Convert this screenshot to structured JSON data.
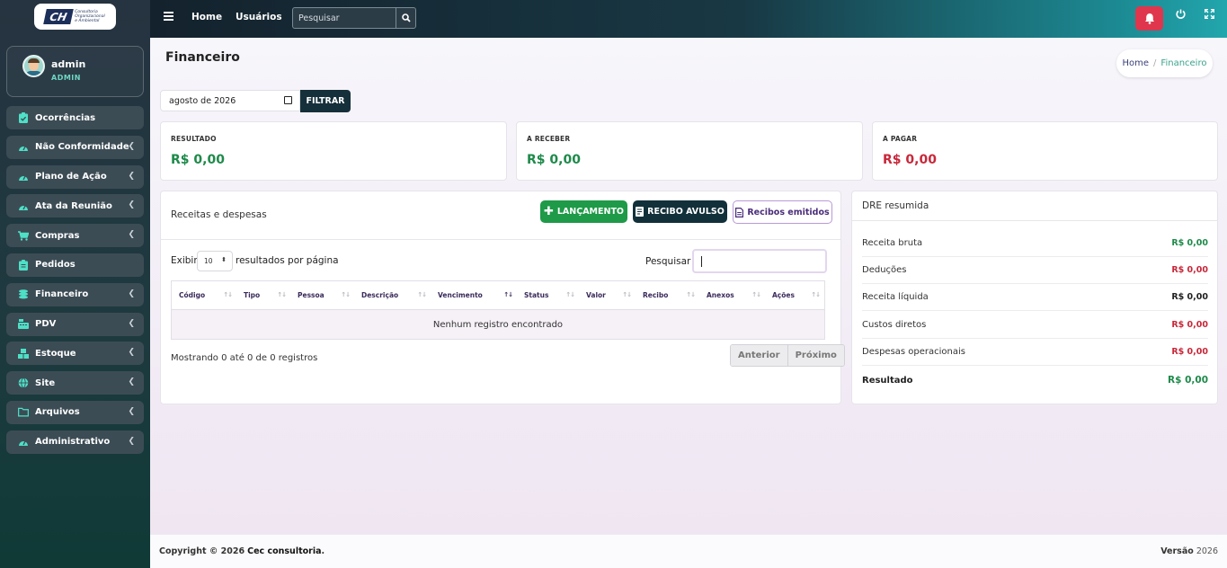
{
  "brand": {
    "logo_mark": "CH",
    "logo_text_lines": [
      "Consultoria",
      "Organizacional",
      "e Ambiental"
    ]
  },
  "user": {
    "name": "admin",
    "role": "ADMIN"
  },
  "sidebar": {
    "items": [
      {
        "label": "Ocorrências",
        "icon": "clipboard-check-icon",
        "has_submenu": false
      },
      {
        "label": "Não Conformidade",
        "icon": "dashboard-gauge-icon",
        "has_submenu": true
      },
      {
        "label": "Plano de Ação",
        "icon": "dashboard-gauge-icon",
        "has_submenu": true
      },
      {
        "label": "Ata da Reunião",
        "icon": "dashboard-gauge-icon",
        "has_submenu": true
      },
      {
        "label": "Compras",
        "icon": "shopping-cart-icon",
        "has_submenu": true
      },
      {
        "label": "Pedidos",
        "icon": "clipboard-list-icon",
        "has_submenu": false
      },
      {
        "label": "Financeiro",
        "icon": "coins-icon",
        "has_submenu": true
      },
      {
        "label": "PDV",
        "icon": "cash-register-icon",
        "has_submenu": true
      },
      {
        "label": "Estoque",
        "icon": "boxes-icon",
        "has_submenu": true
      },
      {
        "label": "Site",
        "icon": "globe-icon",
        "has_submenu": true
      },
      {
        "label": "Arquivos",
        "icon": "folder-icon",
        "has_submenu": true
      },
      {
        "label": "Administrativo",
        "icon": "dashboard-gauge-icon",
        "has_submenu": true
      }
    ]
  },
  "topbar": {
    "home_label": "Home",
    "users_label": "Usuários",
    "search_placeholder": "Pesquisar"
  },
  "page": {
    "title": "Financeiro",
    "breadcrumb": {
      "home": "Home",
      "separator": "/",
      "current": "Financeiro"
    }
  },
  "filter": {
    "month_value": "agosto de 2026",
    "button_label": "FILTRAR"
  },
  "stats": [
    {
      "label": "RESULTADO",
      "value": "R$ 0,00",
      "color": "#1e8a4a"
    },
    {
      "label": "A RECEBER",
      "value": "R$ 0,00",
      "color": "#1e8a4a"
    },
    {
      "label": "A PAGAR",
      "value": "R$ 0,00",
      "color": "#c8283a"
    }
  ],
  "transactions": {
    "title": "Receitas e despesas",
    "add_button": "LANÇAMENTO",
    "receipt_button": "RECIBO AVULSO",
    "issued_button": "Recibos emitidos",
    "length_prefix": "Exibir",
    "length_value": "10",
    "length_suffix": "resultados por página",
    "search_label": "Pesquisar",
    "search_value": "",
    "columns": [
      "Código",
      "Tipo",
      "Pessoa",
      "Descrição",
      "Vencimento",
      "Status",
      "Valor",
      "Recibo",
      "Anexos",
      "Ações"
    ],
    "sorted_column": "Vencimento",
    "empty_message": "Nenhum registro encontrado",
    "info": "Mostrando 0 até 0 de 0 registros",
    "prev_label": "Anterior",
    "next_label": "Próximo"
  },
  "dre": {
    "title": "DRE resumida",
    "rows": [
      {
        "label": "Receita bruta",
        "value": "R$ 0,00",
        "color": "#1e8a4a"
      },
      {
        "label": "Deduções",
        "value": "R$ 0,00",
        "color": "#c8283a"
      },
      {
        "label": "Receita líquida",
        "value": "R$ 0,00",
        "color": "#222222"
      },
      {
        "label": "Custos diretos",
        "value": "R$ 0,00",
        "color": "#c8283a"
      },
      {
        "label": "Despesas operacionais",
        "value": "R$ 0,00",
        "color": "#c8283a"
      },
      {
        "label": "Resultado",
        "value": "R$ 0,00",
        "color": "#1e8a4a"
      }
    ]
  },
  "footer": {
    "copyright_prefix": "Copyright © 2026",
    "company": "Cec consultoria",
    "version_label": "Versão",
    "version_value": "2026"
  },
  "colors": {
    "accent_green": "#1e9a48",
    "danger": "#e0364d",
    "dark": "#12303a"
  }
}
